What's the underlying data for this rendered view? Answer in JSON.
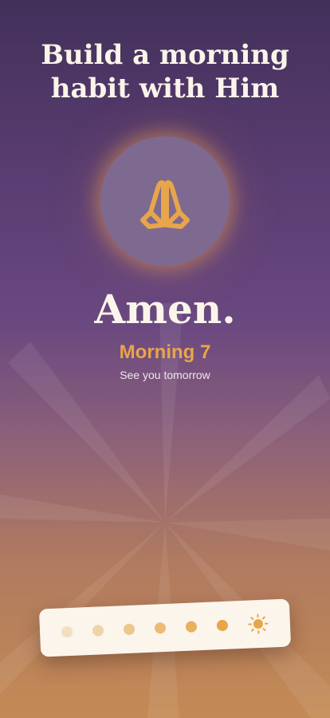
{
  "header": {
    "title_line1": "Build a morning",
    "title_line2": "habit with Him"
  },
  "hero": {
    "icon": "praying-hands-icon",
    "accent_color": "#e8a54a"
  },
  "completion": {
    "heading": "Amen.",
    "streak_label": "Morning 7",
    "subtitle": "See you tomorrow"
  },
  "progress": {
    "days_completed": 7,
    "total_days": 7,
    "dot_colors": [
      "#f2dfbf",
      "#efd4a8",
      "#edc78c",
      "#ebbb73",
      "#e9b05e",
      "#e8a54a"
    ],
    "final_icon": "sun-icon"
  }
}
